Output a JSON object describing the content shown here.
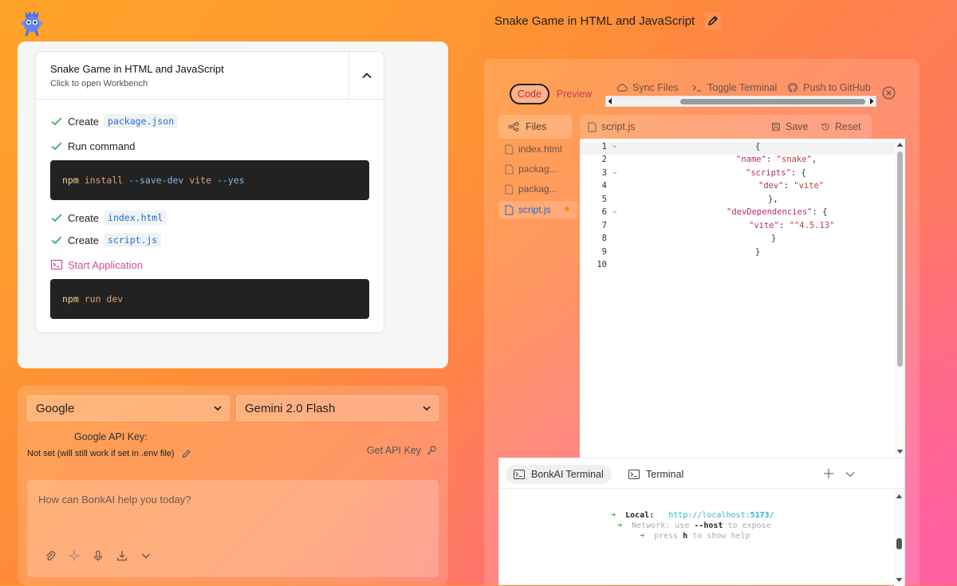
{
  "header": {
    "title": "Snake Game in HTML and JavaScript",
    "logo_icon": "robot-mascot-icon",
    "edit_icon": "pencil-icon"
  },
  "artifact": {
    "title": "Snake Game in HTML and JavaScript",
    "subtitle": "Click to open Workbench",
    "steps": [
      {
        "label": "Create",
        "code": "package.json"
      },
      {
        "label": "Run command"
      },
      {
        "label": "Create",
        "code": "index.html"
      },
      {
        "label": "Create",
        "code": "script.js"
      },
      {
        "label": "Start Application"
      }
    ],
    "command_1": {
      "npm": "npm",
      "install": "install",
      "flags": "--save-dev",
      "pkg": "vite",
      "yes": "--yes"
    },
    "command_2": {
      "npm": "npm",
      "rest": "run dev"
    }
  },
  "input_panel": {
    "provider": "Google",
    "model": "Gemini 2.0 Flash",
    "api_key_label": "Google API Key:",
    "api_key_status": "Not set (will still work if set in .env file)",
    "get_api_key": "Get API Key",
    "prompt_placeholder": "How can BonkAI help you today?"
  },
  "workbench": {
    "tabs": [
      "Code",
      "Preview"
    ],
    "actions": {
      "sync": "Sync Files",
      "toggle_terminal": "Toggle Terminal",
      "push": "Push to GitHub"
    },
    "files_label": "Files",
    "files": [
      "index.html",
      "packag...",
      "packag...",
      "script.js"
    ],
    "selected_file": "script.js",
    "save_label": "Save",
    "reset_label": "Reset",
    "editor_lines": [
      "1",
      "2",
      "3",
      "4",
      "5",
      "6",
      "7",
      "8",
      "9",
      "10"
    ],
    "code": {
      "l1": "{",
      "name_key": "\"name\"",
      "name_val": "\"snake\"",
      "scripts_key": "\"scripts\"",
      "dev_key": "\"dev\"",
      "dev_val": "\"vite\"",
      "l5": "},",
      "devdeps_key": "\"devDependencies\"",
      "vite_key": "\"vite\"",
      "vite_val": "\"^4.5.13\"",
      "l8": "}",
      "l9": "}"
    },
    "terminal": {
      "tabs": [
        "BonkAI Terminal",
        "Terminal"
      ],
      "arrow": "➜",
      "local_label": "Local:",
      "local_url_base": "http://localhost:",
      "local_port": "5173",
      "local_url_end": "/",
      "network_label": "Network:",
      "network_pre": "use",
      "network_host": "--host",
      "network_post": "to expose",
      "press": "press",
      "h": "h",
      "help": "to show help"
    }
  },
  "colors": {
    "accent_pink": "#d24d9a",
    "code_blue": "#1f6fd1",
    "check_green": "#3aa55d"
  }
}
